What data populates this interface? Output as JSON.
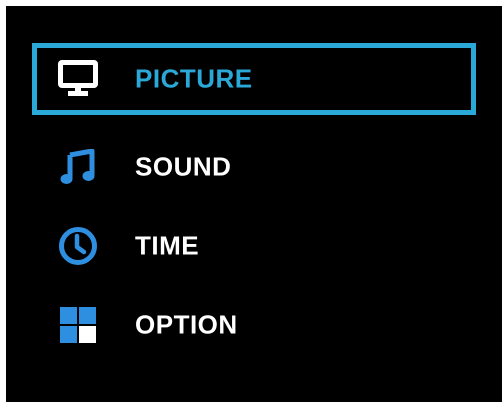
{
  "menu": {
    "items": [
      {
        "label": "PICTURE",
        "icon": "monitor-icon",
        "selected": true
      },
      {
        "label": "SOUND",
        "icon": "music-note-icon",
        "selected": false
      },
      {
        "label": "TIME",
        "icon": "clock-icon",
        "selected": false
      },
      {
        "label": "OPTION",
        "icon": "grid-options-icon",
        "selected": false
      }
    ]
  },
  "colors": {
    "accent": "#2aa8d8",
    "background": "#000000",
    "text": "#ffffff"
  }
}
